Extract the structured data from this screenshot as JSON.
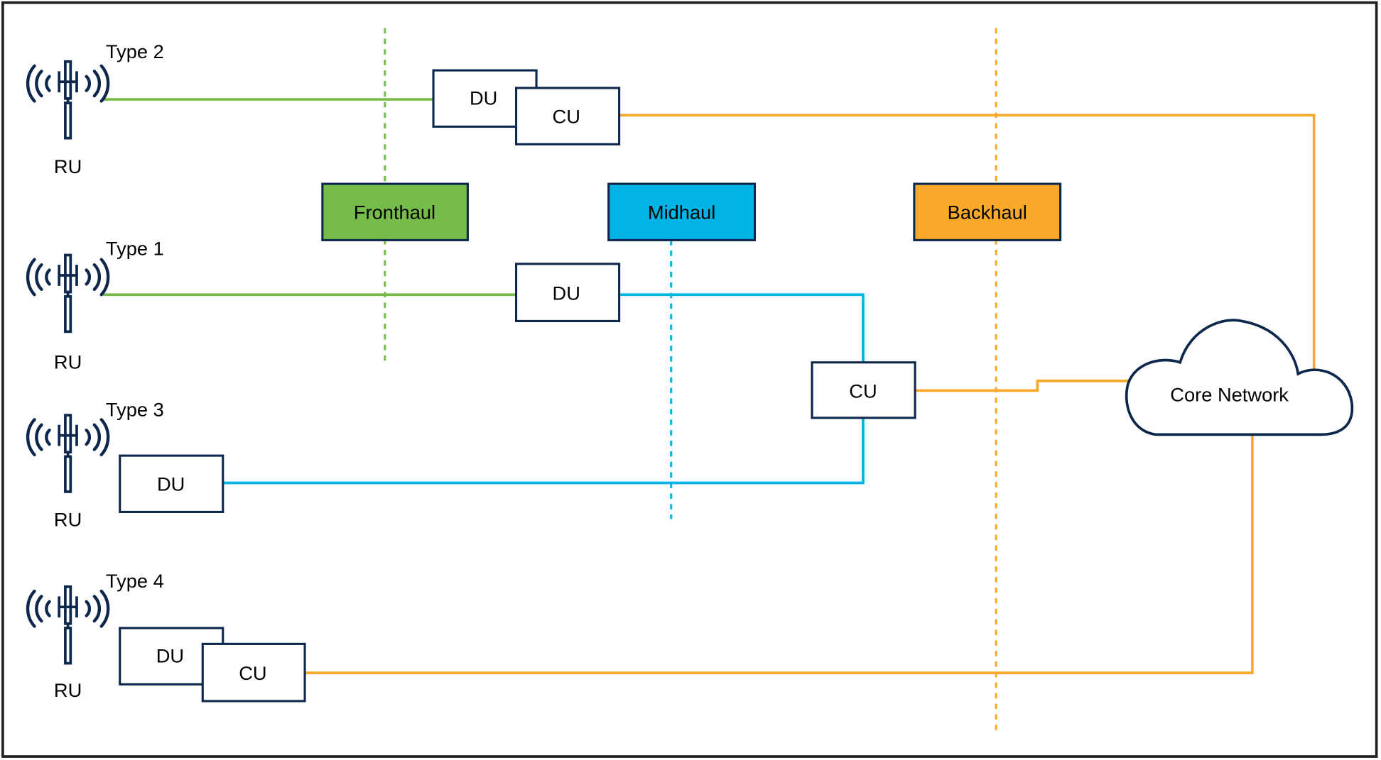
{
  "colors": {
    "fronthaul": "#76bc4a",
    "midhaul": "#00b5e6",
    "backhaul": "#f9a92a",
    "outline": "#0d274d",
    "frame": "#222222"
  },
  "icons": {
    "radio_unit": "antenna-tower-icon",
    "core": "cloud-icon"
  },
  "types": [
    {
      "label": "Type 2",
      "ru": "RU",
      "du": "DU",
      "cu": "CU"
    },
    {
      "label": "Type 1",
      "ru": "RU",
      "du": "DU"
    },
    {
      "label": "Type 3",
      "ru": "RU",
      "du": "DU"
    },
    {
      "label": "Type 4",
      "ru": "RU",
      "du": "DU",
      "cu": "CU"
    }
  ],
  "shared_cu": "CU",
  "segments": {
    "fronthaul": "Fronthaul",
    "midhaul": "Midhaul",
    "backhaul": "Backhaul"
  },
  "core": "Core Network"
}
